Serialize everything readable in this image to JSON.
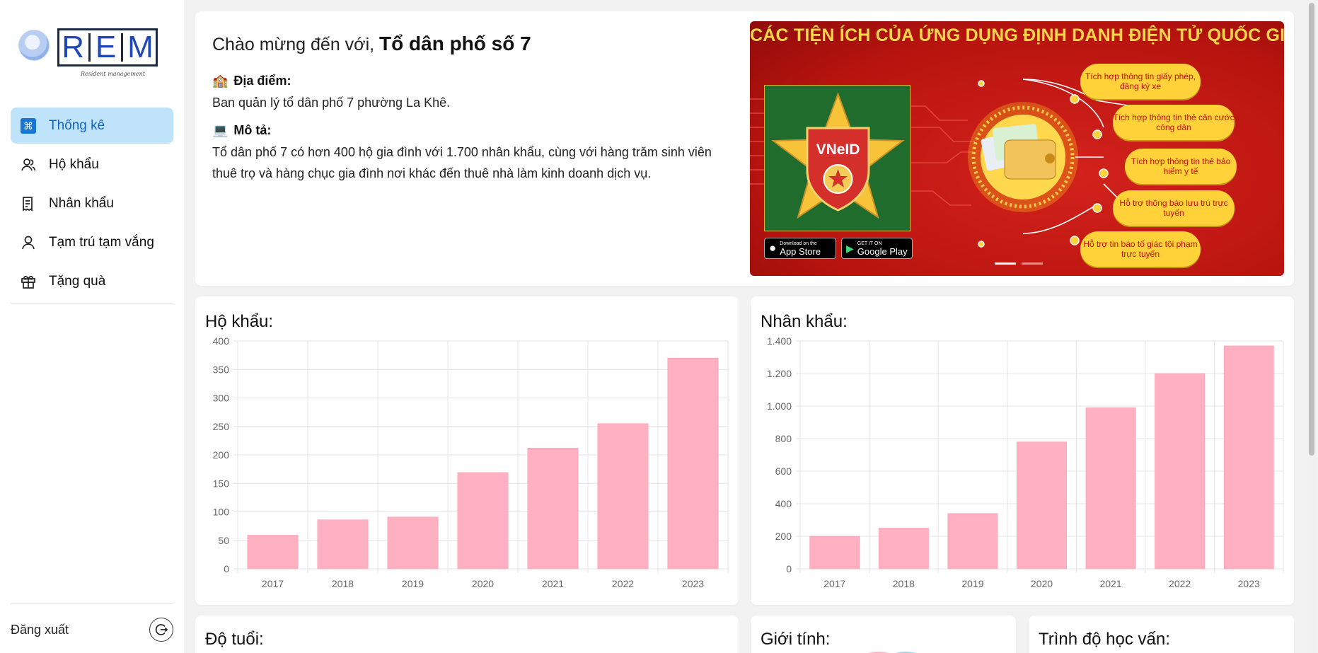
{
  "sidebar": {
    "logo_letters": [
      "R",
      "E",
      "M"
    ],
    "logo_subtitle": "Resident management",
    "items": [
      {
        "label": "Thống kê",
        "icon": "command-icon",
        "active": true
      },
      {
        "label": "Hộ khẩu",
        "icon": "users-icon",
        "active": false
      },
      {
        "label": "Nhân khẩu",
        "icon": "document-list-icon",
        "active": false
      },
      {
        "label": "Tạm trú tạm vắng",
        "icon": "user-icon",
        "active": false
      },
      {
        "label": "Tặng quà",
        "icon": "gift-icon",
        "active": false
      }
    ],
    "logout_label": "Đăng xuất"
  },
  "welcome": {
    "greeting": "Chào mừng đến với,",
    "place_name": "Tổ dân phố số 7",
    "location_label": "Địa điểm:",
    "location_text": "Ban quản lý tổ dân phố 7 phường La Khê.",
    "description_label": "Mô tả:",
    "description_text": "Tổ dân phố 7 có hơn 400 hộ gia đình với 1.700 nhân khẩu, cùng với hàng trăm sinh viên thuê trọ và hàng chục gia đình nơi khác đến thuê nhà làm kinh doanh dịch vụ."
  },
  "banner": {
    "title": "CÁC TIỆN ÍCH CỦA ỨNG DỤNG ĐỊNH DANH ĐIỆN TỬ QUỐC GIA",
    "logo_text": "VNeID",
    "app_store": {
      "small": "Download on the",
      "big": "App Store"
    },
    "google_play": {
      "small": "GET IT ON",
      "big": "Google Play"
    },
    "features": [
      "Tích hợp thông tin giấy phép, đăng ký xe",
      "Tích hợp thông tin thẻ căn cước công dân",
      "Tích hợp thông tin thẻ bảo hiểm y tế",
      "Hỗ trợ thông báo lưu trú trực tuyến",
      "Hỗ trợ tin báo tố giác tội phạm trực tuyến"
    ],
    "colors": {
      "background": "#c8140f",
      "accent": "#ffd23a"
    }
  },
  "chart_data": [
    {
      "type": "bar",
      "title": "Hộ khẩu:",
      "categories": [
        "2017",
        "2018",
        "2019",
        "2020",
        "2021",
        "2022",
        "2023"
      ],
      "values": [
        59,
        86,
        91,
        169,
        212,
        255,
        370
      ],
      "ylim": [
        0,
        400
      ],
      "yticks": [
        0,
        50,
        100,
        150,
        200,
        250,
        300,
        350,
        400
      ],
      "ytick_labels": [
        "0",
        "50",
        "100",
        "150",
        "200",
        "250",
        "300",
        "350",
        "400"
      ],
      "color": "#ffb1c1",
      "grid": true
    },
    {
      "type": "bar",
      "title": "Nhân khẩu:",
      "categories": [
        "2017",
        "2018",
        "2019",
        "2020",
        "2021",
        "2022",
        "2023"
      ],
      "values": [
        200,
        250,
        340,
        780,
        990,
        1200,
        1370
      ],
      "ylim": [
        0,
        1400
      ],
      "yticks": [
        0,
        200,
        400,
        600,
        800,
        1000,
        1200,
        1400
      ],
      "ytick_labels": [
        "0",
        "200",
        "400",
        "600",
        "800",
        "1.000",
        "1.200",
        "1.400"
      ],
      "color": "#ffb1c1",
      "grid": true
    }
  ],
  "bottom_cards": [
    {
      "title": "Độ tuổi:"
    },
    {
      "title": "Giới tính:"
    },
    {
      "title": "Trình độ học vấn:"
    }
  ]
}
